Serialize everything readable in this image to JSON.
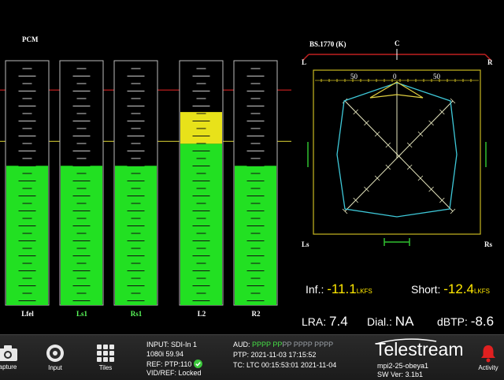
{
  "meters": {
    "section_label": "PCM",
    "channels": [
      {
        "label": "Lfel",
        "level": 0.57,
        "label_color": "#ffffff",
        "fill": "green"
      },
      {
        "label": "Ls1",
        "level": 0.57,
        "label_color": "#5cff5c",
        "fill": "green"
      },
      {
        "label": "Rs1",
        "level": 0.57,
        "label_color": "#5cff5c",
        "fill": "green"
      },
      {
        "label": "L2",
        "level": 0.79,
        "label_color": "#ffffff",
        "fill": "green-yellow"
      },
      {
        "label": "R2",
        "level": 0.57,
        "label_color": "#ffffff",
        "fill": "green"
      }
    ],
    "red_line_level": 0.88,
    "yellow_line_level": 0.67
  },
  "surround": {
    "title": "BS.1770 (K)",
    "center_label": "C",
    "left_label": "L",
    "right_label": "R",
    "ls_label": "Ls",
    "rs_label": "Rs",
    "scale_left": "50",
    "scale_center": "0",
    "scale_right": "50"
  },
  "readouts": {
    "inf_label": "Inf.:",
    "inf_value": "-11.1",
    "inf_unit": "LKFS",
    "short_label": "Short:",
    "short_value": "-12.4",
    "short_unit": "LKFS",
    "lra_label": "LRA:",
    "lra_value": "7.4",
    "dial_label": "Dial.:",
    "dial_value": "NA",
    "dbtp_label": "dBTP:",
    "dbtp_value": "-8.6"
  },
  "toolbar": {
    "capture_label": "apture",
    "input_label": "Input",
    "tiles_label": "Tiles",
    "activity_label": "Activity"
  },
  "status": {
    "input": "INPUT: SDI-In 1",
    "format": "1080i 59.94",
    "ref": "REF: PTP:110",
    "vidref": "VID/REF: Locked",
    "aud_label": "AUD:",
    "aud_green": "PPPP PP",
    "aud_grey": "PP PPPP PPPP",
    "ptp": "PTP: 2021-11-03 17:15:52",
    "tc": "TC: LTC 00:15:53:01 2021-11-04"
  },
  "device": {
    "brand": "Telestream",
    "hostname": "mpi2-25-obeya1",
    "sw_version": "SW Ver: 3.1b1"
  },
  "colors": {
    "meter_green": "#22e022",
    "meter_yellow": "#e8e21a",
    "trace_cyan": "#3ec8d8",
    "trace_yellow": "#e0d040",
    "alert_red": "#e02020"
  }
}
